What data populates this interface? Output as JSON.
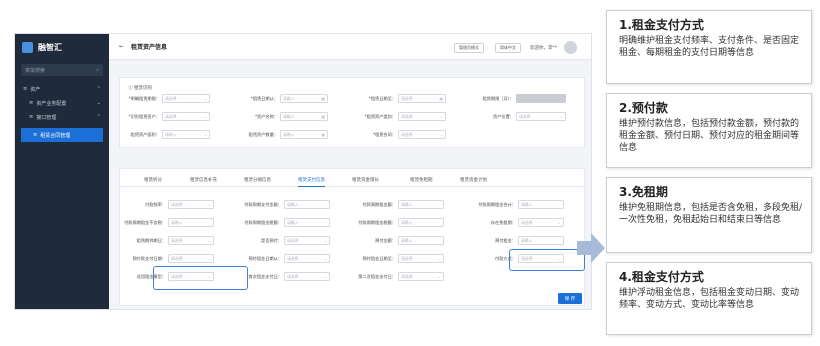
{
  "sidebar": {
    "brand": "融智汇",
    "search_placeholder": "菜单搜索",
    "items": [
      {
        "label": "资产"
      },
      {
        "label": "资产业务配置"
      },
      {
        "label": "接口管理"
      },
      {
        "label": "租赁合同管理"
      }
    ]
  },
  "topbar": {
    "back": "←",
    "title": "租赁资产信息",
    "btn1": "管理员模式",
    "btn2": "简体中文",
    "user": "欢迎你，李**"
  },
  "form": {
    "section_title": "租赁识别",
    "row1": [
      {
        "label": "*明确租赁期限：",
        "placeholder": "请选择"
      },
      {
        "label": "*租赁日期从：",
        "placeholder": "请输入"
      },
      {
        "label": "*租赁日期至：",
        "placeholder": "请选择"
      },
      {
        "label": "租赁期限（月）：",
        "placeholder": ""
      }
    ],
    "row2": [
      {
        "label": "*识别租赁资产：",
        "placeholder": "请选择"
      },
      {
        "label": "*资产名称：",
        "placeholder": "请输入"
      },
      {
        "label": "*租赁资产类别：",
        "placeholder": "请选择"
      },
      {
        "label": "资产位置：",
        "placeholder": "请选择"
      }
    ],
    "row3": [
      {
        "label": "租赁资产面积：",
        "placeholder": "请输入"
      },
      {
        "label": "租赁资产数量：",
        "placeholder": "请输入"
      },
      {
        "label": "*租赁合同：",
        "placeholder": "请选择"
      }
    ]
  },
  "tabs": [
    "租赁拆分",
    "租赁信息补充",
    "租赁分摊信息",
    "租赁支付信息",
    "租赁资金增长",
    "租赁免租期",
    "租赁资金计划"
  ],
  "pay": {
    "rows": [
      [
        {
          "label": "付款频率：",
          "ph": "请选择"
        },
        {
          "label": "付款周期支付金额：",
          "ph": "请输入"
        },
        {
          "label": "付款周期租金额：",
          "ph": "请输入"
        },
        {
          "label": "付款周期租金合计：",
          "ph": "请输入"
        }
      ],
      [
        {
          "label": "付款周期租金不含税：",
          "ph": "请输入"
        },
        {
          "label": "付款周期租金税额：",
          "ph": "请输入"
        },
        {
          "label": "付款周期租金税额：",
          "ph": "请输入"
        },
        {
          "label": "存在免租期：",
          "ph": "请选择"
        }
      ],
      [
        {
          "label": "租赁期到期日：",
          "ph": "请选择"
        },
        {
          "label": "是否预付：",
          "ph": "请选择"
        },
        {
          "label": "预付金额：",
          "ph": "请输入"
        },
        {
          "label": "预付租金：",
          "ph": "请输入"
        }
      ],
      [
        {
          "label": "预付款支付日期：",
          "ph": "请选择"
        },
        {
          "label": "预付租金日期从：",
          "ph": "请选择"
        },
        {
          "label": "预付租金日期至：",
          "ph": "请选择"
        },
        {
          "label": "付款方式：",
          "ph": "请选择"
        }
      ],
      [
        {
          "label": "适用租金模型：",
          "ph": "请选择"
        },
        {
          "label": "首次租金支付日：",
          "ph": "请选择"
        },
        {
          "label": "第二次租金支付日：",
          "ph": "请选择"
        }
      ]
    ],
    "save": "保 存"
  },
  "notes": [
    {
      "title": "1.租金支付方式",
      "body": "明确维护租金支付频率、支付条件、是否固定租金、每期租金的支付日期等信息"
    },
    {
      "title": "2.预付款",
      "body": "维护预付款信息，包括预付款金额，预付款的租金金额、预付日期、预付对应的租金期间等信息"
    },
    {
      "title": "3.免租期",
      "body": "维护免租期信息，包括是否含免租，多段免租/一次性免租，免租起始日和结束日等信息"
    },
    {
      "title": "4.租金支付方式",
      "body": "维护浮动租金信息，包括租金变动日期、变动频率、变动方式、变动比率等信息"
    }
  ],
  "colors": {
    "accent": "#1c6fd6",
    "sidebar": "#1f2a3a",
    "highlight": "#3d7fe0"
  }
}
